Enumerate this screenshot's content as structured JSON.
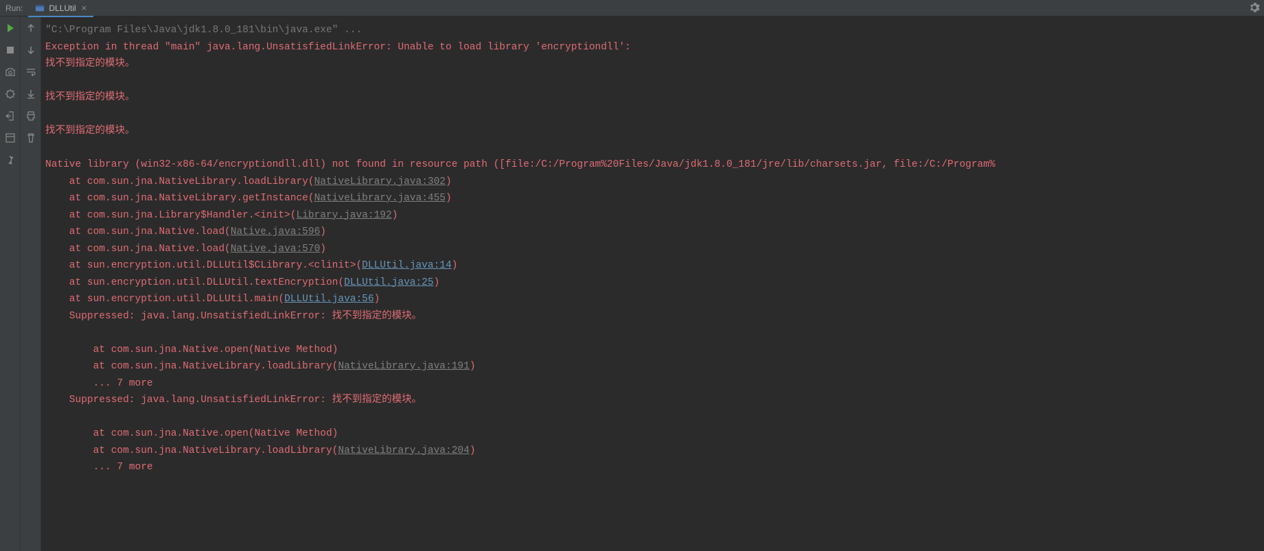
{
  "header": {
    "run_label": "Run:",
    "tab_name": "DLLUtil",
    "tab_close": "×"
  },
  "console": {
    "cmd": "\"C:\\Program Files\\Java\\jdk1.8.0_181\\bin\\java.exe\" ...",
    "ex_line": "Exception in thread \"main\" java.lang.UnsatisfiedLinkError: Unable to load library 'encryptiondll':",
    "mod_not_found": "找不到指定的模块。",
    "native_line": "Native library (win32-x86-64/encryptiondll.dll) not found in resource path ([file:/C:/Program%20Files/Java/jdk1.8.0_181/jre/lib/charsets.jar, file:/C:/Program%",
    "frames": [
      {
        "pre": "at com.sun.jna.NativeLibrary.loadLibrary(",
        "link": "NativeLibrary.java:302",
        "blue": false
      },
      {
        "pre": "at com.sun.jna.NativeLibrary.getInstance(",
        "link": "NativeLibrary.java:455",
        "blue": false
      },
      {
        "pre": "at com.sun.jna.Library$Handler.<init>(",
        "link": "Library.java:192",
        "blue": false
      },
      {
        "pre": "at com.sun.jna.Native.load(",
        "link": "Native.java:596",
        "blue": false
      },
      {
        "pre": "at com.sun.jna.Native.load(",
        "link": "Native.java:570",
        "blue": false
      },
      {
        "pre": "at sun.encryption.util.DLLUtil$CLibrary.<clinit>(",
        "link": "DLLUtil.java:14",
        "blue": true
      },
      {
        "pre": "at sun.encryption.util.DLLUtil.textEncryption(",
        "link": "DLLUtil.java:25",
        "blue": true
      },
      {
        "pre": "at sun.encryption.util.DLLUtil.main(",
        "link": "DLLUtil.java:56",
        "blue": true
      }
    ],
    "suppressed": "Suppressed: java.lang.UnsatisfiedLinkError: 找不到指定的模块。",
    "sup_blocks": [
      {
        "lines": [
          {
            "raw": "at com.sun.jna.Native.open(Native Method)"
          },
          {
            "pre": "at com.sun.jna.NativeLibrary.loadLibrary(",
            "link": "NativeLibrary.java:191"
          },
          {
            "raw": "... 7 more"
          }
        ]
      },
      {
        "lines": [
          {
            "raw": "at com.sun.jna.Native.open(Native Method)"
          },
          {
            "pre": "at com.sun.jna.NativeLibrary.loadLibrary(",
            "link": "NativeLibrary.java:204"
          },
          {
            "raw": "... 7 more"
          }
        ]
      }
    ]
  }
}
